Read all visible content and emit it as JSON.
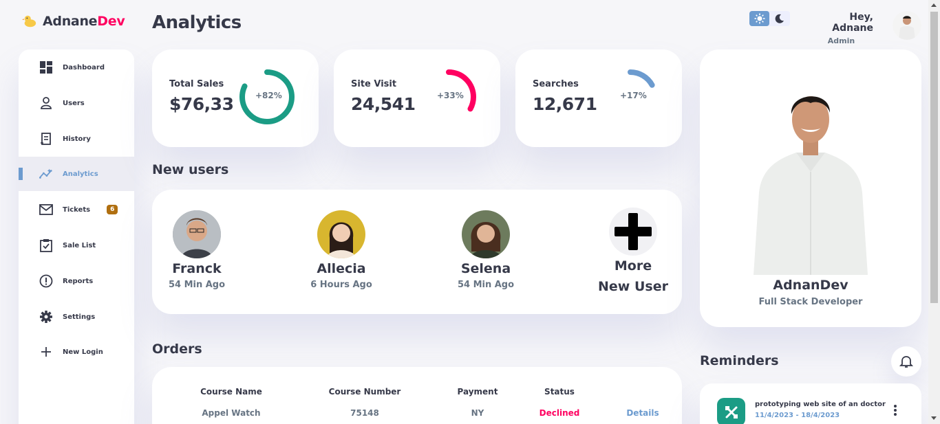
{
  "brand": {
    "name_main": "Adnane",
    "name_accent": "Dev",
    "accent_color": "#ff0060"
  },
  "page_title": "Analytics",
  "sidebar": {
    "items": [
      {
        "label": "Dashboard",
        "icon": "dashboard-icon"
      },
      {
        "label": "Users",
        "icon": "user-icon"
      },
      {
        "label": "History",
        "icon": "receipt-icon"
      },
      {
        "label": "Analytics",
        "icon": "insights-icon",
        "active": true
      },
      {
        "label": "Tickets",
        "icon": "mail-icon",
        "badge": "6"
      },
      {
        "label": "Sale List",
        "icon": "clipboard-check-icon"
      },
      {
        "label": "Reports",
        "icon": "report-icon"
      },
      {
        "label": "Settings",
        "icon": "gear-icon"
      },
      {
        "label": "New Login",
        "icon": "plus-icon"
      }
    ]
  },
  "stats": [
    {
      "label": "Total Sales",
      "value": "$76,33",
      "percent_label": "+82%",
      "percent": 82,
      "color": "#1b9c85"
    },
    {
      "label": "Site Visit",
      "value": "24,541",
      "percent_label": "+33%",
      "percent": 33,
      "color": "#ff0060"
    },
    {
      "label": "Searches",
      "value": "12,671",
      "percent_label": "+17%",
      "percent": 17,
      "color": "#6c9bcf"
    }
  ],
  "new_users": {
    "title": "New users",
    "users": [
      {
        "name": "Franck",
        "time": "54 Min Ago"
      },
      {
        "name": "Allecia",
        "time": "6 Hours Ago"
      },
      {
        "name": "Selena",
        "time": "54 Min Ago"
      }
    ],
    "more_line1": "More",
    "more_line2": "New User"
  },
  "orders": {
    "title": "Orders",
    "columns": [
      "Course Name",
      "Course Number",
      "Payment",
      "Status",
      ""
    ],
    "rows": [
      {
        "course_name": "Appel Watch",
        "course_number": "75148",
        "payment": "NY",
        "status": "Declined",
        "action": "Details"
      }
    ]
  },
  "header": {
    "greeting_prefix": "Hey, ",
    "user_name": "Adnane",
    "role": "Admin"
  },
  "profile": {
    "name": "AdnanDev",
    "title": "Full Stack Developer"
  },
  "reminders": {
    "title": "Reminders",
    "items": [
      {
        "text": "prototyping web site of an doctor",
        "date": "11/4/2023 - 18/4/2023"
      }
    ]
  }
}
